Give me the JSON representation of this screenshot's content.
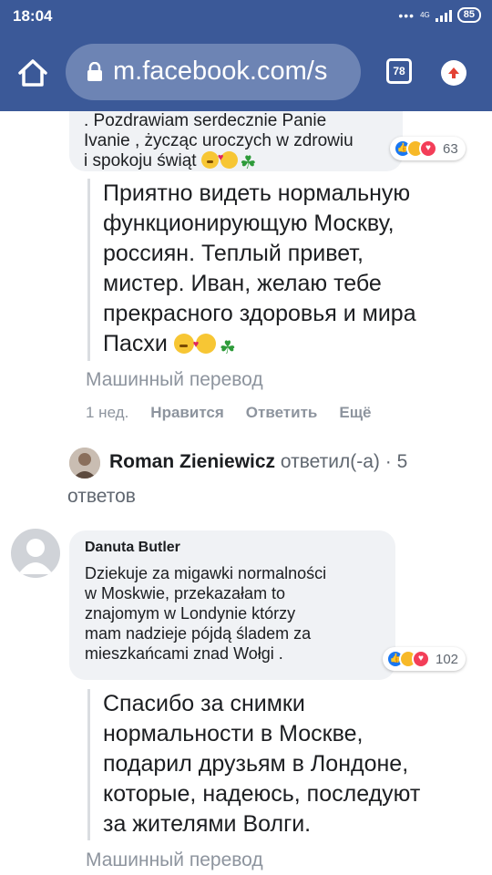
{
  "status_bar": {
    "time": "18:04",
    "network": "4G",
    "battery": "85"
  },
  "browser": {
    "url": "m.facebook.com/s",
    "tab_count": "78"
  },
  "comments": [
    {
      "visible_text": ": Pozdrawiam serdecznie Panie Ivanie , życząc uroczych w zdrowiu i spokoju świąt",
      "line1": ". Pozdrawiam serdecznie Panie",
      "line2": "Ivanie , życząc uroczych w zdrowiu",
      "line3": "i spokoju świąt",
      "reaction_count": "63",
      "translation_lines": [
        "Приятно видеть нормальную",
        "функционирующую Москву,",
        "россиян. Теплый привет,",
        "мистер. Иван, желаю тебе",
        "прекрасного здоровья и мира",
        "Пасхи"
      ],
      "machine_translation_label": "Машинный перевод",
      "time_ago": "1 нед.",
      "like_action": "Нравится",
      "reply_action": "Ответить",
      "more_action": "Ещё"
    },
    {
      "author": "Danuta Butler",
      "text_lines": [
        "Dziekuje za migawki normalności",
        "w Moskwie, przekazałam to",
        "znajomym w Londynie którzy",
        "mam nadzieje pójdą śladem za",
        "mieszkańcami znad Wołgi ."
      ],
      "reaction_count": "102",
      "translation_lines": [
        "Спасибо за снимки",
        "нормальности в Москве,",
        "подарил друзьям в Лондоне,",
        "которые, надеюсь, последуют",
        "за жителями Волги."
      ],
      "machine_translation_label": "Машинный перевод"
    }
  ],
  "reply_summary": {
    "name": "Roman Zieniewicz",
    "action": "ответил(-а)",
    "separator": "·",
    "count": "5",
    "unit": "ответов"
  },
  "colors": {
    "header": "#3b5998",
    "url_box": "#6d84b4",
    "bubble": "#f0f2f5",
    "muted_text": "#8d949e"
  }
}
